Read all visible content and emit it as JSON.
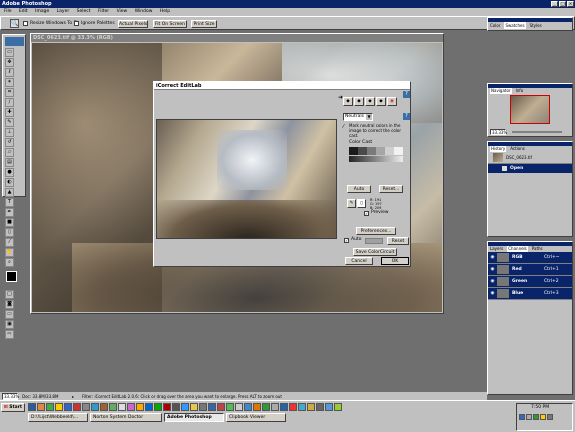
{
  "app": {
    "title": "Adobe Photoshop",
    "menu": [
      "File",
      "Edit",
      "Image",
      "Layer",
      "Select",
      "Filter",
      "View",
      "Window",
      "Help"
    ]
  },
  "options_bar": {
    "resize_windows": "Resize Windows To Fit",
    "ignore_palettes": "Ignore Palettes",
    "actual_pixels": "Actual Pixels",
    "fit_on_screen": "Fit On Screen",
    "print_size": "Print Size"
  },
  "document": {
    "title": "DSC_0623.tif @ 33.3% (RGB)"
  },
  "dialog": {
    "title": "iCorrect EditLab",
    "mode_select": "Neutrals",
    "instruction": "Mark neutral colors in the image to correct the color cast.",
    "color_cast_label": "Color Cast",
    "auto_label": "Auto",
    "reset_label": "Reset...",
    "preview_label": "Preview",
    "preferences_label": "Preferences...",
    "auto_check_label": "Auto",
    "reset2_label": "Reset",
    "save_label": "Save ColorCircuit",
    "cancel_label": "Cancel",
    "ok_label": "OK",
    "readouts": [
      "R: 191",
      "G: 197",
      "B: 209"
    ],
    "swatch_colors": [
      "#1a1a1a",
      "#4a4a4a",
      "#7a7a7a",
      "#a6a6a6",
      "#d0d0d0",
      "#f2f2f2"
    ]
  },
  "palettes": {
    "color_tabs": [
      "Color",
      "Swatches",
      "Styles"
    ],
    "navigator_tabs": [
      "Navigator",
      "Info"
    ],
    "zoom": "33.33%",
    "history_tabs": [
      "History",
      "Actions"
    ],
    "history_items": [
      "DSC_0623.tif",
      "Open"
    ],
    "layers_tabs": [
      "Layers",
      "Channels",
      "Paths"
    ],
    "channels": [
      {
        "name": "RGB",
        "shortcut": "Ctrl+~"
      },
      {
        "name": "Red",
        "shortcut": "Ctrl+1"
      },
      {
        "name": "Green",
        "shortcut": "Ctrl+2"
      },
      {
        "name": "Blue",
        "shortcut": "Ctrl+3"
      }
    ]
  },
  "status_bar": {
    "zoom": "33.33%",
    "doc": "Doc: 33.8M/33.8M",
    "message": "Filter: iCorrect EditLab 2.0.6: Click or drag over the area you want to enlarge. Press ALT to zoom out"
  },
  "taskbar": {
    "start": "Start",
    "tasks": [
      "D:\\!Lijst\\Webbeeld\\...",
      "Norton System Doctor",
      "Adobe Photoshop",
      "Clipbook Viewer"
    ],
    "clock": "7:50 PM"
  },
  "colors": {
    "desktop": "#6f6f6f",
    "titlebar_active": "#0a246a",
    "chrome": "#c0c0c0",
    "history_open_row": "#0a246a"
  }
}
